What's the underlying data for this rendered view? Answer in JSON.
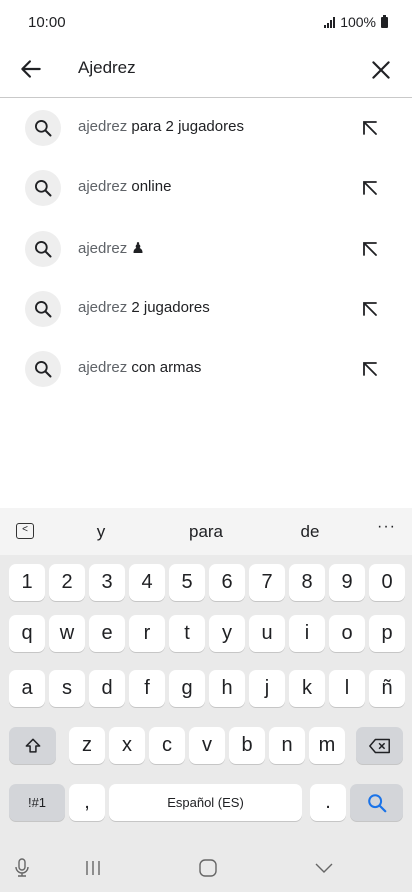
{
  "status": {
    "time": "10:00",
    "battery": "100%"
  },
  "search": {
    "query": "Ajedrez"
  },
  "suggestions": [
    {
      "typed": "ajedrez",
      "rest": " para 2 jugadores"
    },
    {
      "typed": "ajedrez",
      "rest": " online"
    },
    {
      "typed": "ajedrez",
      "rest": " ♟"
    },
    {
      "typed": "ajedrez",
      "rest": " 2 jugadores"
    },
    {
      "typed": "ajedrez",
      "rest": " con armas"
    }
  ],
  "keyboard": {
    "predictions": [
      "y",
      "para",
      "de"
    ],
    "more": "···",
    "numbers": [
      "1",
      "2",
      "3",
      "4",
      "5",
      "6",
      "7",
      "8",
      "9",
      "0"
    ],
    "row1": [
      "q",
      "w",
      "e",
      "r",
      "t",
      "y",
      "u",
      "i",
      "o",
      "p"
    ],
    "row2": [
      "a",
      "s",
      "d",
      "f",
      "g",
      "h",
      "j",
      "k",
      "l",
      "ñ"
    ],
    "row3": [
      "z",
      "x",
      "c",
      "v",
      "b",
      "n",
      "m"
    ],
    "symbols": "!#1",
    "comma": ",",
    "space": "Español (ES)",
    "period": "."
  },
  "colors": {
    "accent": "#1a73e8",
    "keyboard_bg": "#eaeaea"
  }
}
